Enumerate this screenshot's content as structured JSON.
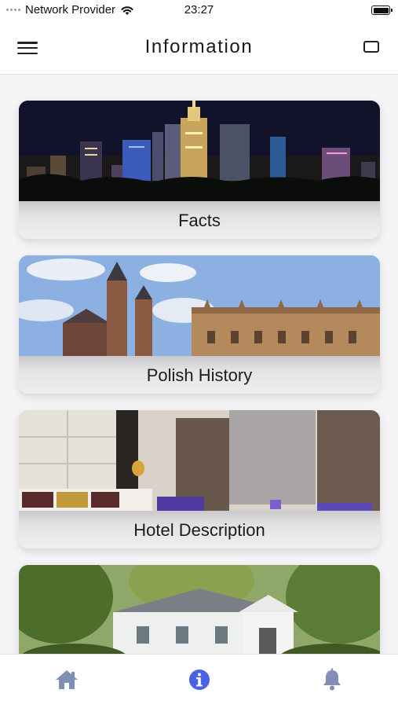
{
  "status_bar": {
    "carrier": "Network Provider",
    "time": "23:27"
  },
  "nav": {
    "title": "Information"
  },
  "cards": [
    {
      "label": "Facts",
      "image": "night-city-skyline-image"
    },
    {
      "label": "Polish History",
      "image": "historic-old-town-image"
    },
    {
      "label": "Hotel Description",
      "image": "hotel-room-image"
    },
    {
      "label": "",
      "image": "manor-house-image"
    }
  ],
  "tab_bar": {
    "items": [
      {
        "icon": "home-icon"
      },
      {
        "icon": "info-icon",
        "active": true
      },
      {
        "icon": "bell-icon"
      }
    ],
    "active_color": "#4a63e6",
    "inactive_color": "#7f8fb5"
  }
}
